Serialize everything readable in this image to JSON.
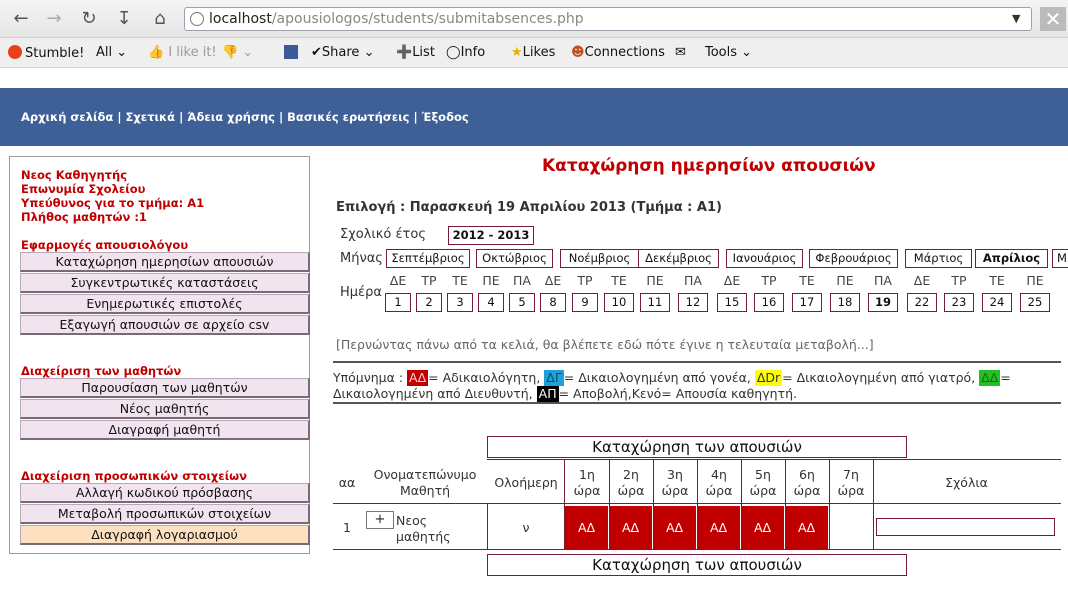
{
  "browser": {
    "url_host": "localhost",
    "url_path": "/apousiologos/students/submitabsences.php"
  },
  "toolbar": {
    "stumble": "Stumble!",
    "all": "All",
    "like": "I like it!",
    "share": "Share",
    "list": "List",
    "info": "Info",
    "likes": "Likes",
    "connections": "Connections",
    "tools": "Tools"
  },
  "topnav": {
    "text": "Αρχική σελίδα | Σχετικά | Άδεια χρήσης | Βασικές ερωτήσεις | Έξοδος"
  },
  "sidebar": {
    "user": "Νεος Καθηγητής",
    "school": "Επωνυμία Σχολείου",
    "responsible": "Υπεύθυνος για το τμήμα: Α1",
    "students_count": "Πλήθος μαθητών :1",
    "apps_title": "Εφαρμογές απουσιολόγου",
    "apps": [
      "Καταχώρηση ημερησίων απουσιών",
      "Συγκεντρωτικές καταστάσεις",
      "Ενημερωτικές επιστολές",
      "Εξαγωγή απουσιών σε αρχείο csv"
    ],
    "students_title": "Διαχείριση των μαθητών",
    "students": [
      "Παρουσίαση των μαθητών",
      "Νέος μαθητής",
      "Διαγραφή μαθητή"
    ],
    "personal_title": "Διαχείριση προσωπικών στοιχείων",
    "personal": [
      "Αλλαγή κωδικού πρόσβασης",
      "Μεταβολή προσωπικών στοιχείων",
      "Διαγραφή λογαριασμού"
    ]
  },
  "main": {
    "title": "Καταχώρηση ημερησίων απουσιών",
    "selection": "Επιλογή : Παρασκευή 19 Απριλίου 2013 (Τμήμα : Α1)",
    "school_year_label": "Σχολικό έτος",
    "school_year": "2012 - 2013",
    "month_label": "Μήνας",
    "months": [
      "Σεπτέμβριος",
      "Οκτώβριος",
      "Νοέμβριος",
      "Δεκέμβριος",
      "Ιανουάριος",
      "Φεβρουάριος",
      "Μάρτιος",
      "Απρίλιος",
      "Μ"
    ],
    "day_label": "Ημέρα",
    "day_names": [
      "ΔΕ",
      "ΤΡ",
      "ΤΕ",
      "ΠΕ",
      "ΠΑ",
      "ΔΕ",
      "ΤΡ",
      "ΤΕ",
      "ΠΕ",
      "ΠΑ",
      "ΔΕ",
      "ΤΡ",
      "ΤΕ",
      "ΠΕ",
      "ΠΑ",
      "ΔΕ",
      "ΤΡ",
      "ΤΕ",
      "ΠΕ"
    ],
    "days": [
      "1",
      "2",
      "3",
      "4",
      "5",
      "8",
      "9",
      "10",
      "11",
      "12",
      "15",
      "16",
      "17",
      "18",
      "19",
      "22",
      "23",
      "24",
      "25"
    ],
    "hint": "[Περνώντας πάνω από τα κελιά, θα βλέπετε εδώ πότε έγινε η τελευταία μεταβολή...]",
    "legend": {
      "prefix": "Υπόμνημα :",
      "ad": "ΑΔ",
      "ad_text": "= Αδικαιολόγητη,",
      "dg": "ΔΓ",
      "dg_text": "= Δικαιολογημένη από γονέα,",
      "ddr": "ΔDr",
      "ddr_text": "= Δικαιολογημένη από γιατρό,",
      "dd": "ΔΔ",
      "dd_text": "= Δικαιολογημένη από Διευθυντή,",
      "ap": "ΑΠ",
      "ap_text": "= Αποβολή,Κενό= Απουσία καθηγητή."
    },
    "section_header": "Καταχώρηση των απουσιών",
    "table": {
      "headers": {
        "aa": "αα",
        "name": "Ονοματεπώνυμο Μαθητή",
        "fullday": "Ολοήμερη",
        "comments": "Σχόλια"
      },
      "hours": [
        "1η ώρα",
        "2η ώρα",
        "3η ώρα",
        "4η ώρα",
        "5η ώρα",
        "6η ώρα",
        "7η ώρα"
      ],
      "rows": [
        {
          "aa": "1",
          "name": "Νεος μαθητής",
          "fullday": "ν",
          "plus": "+",
          "hours": [
            "ΑΔ",
            "ΑΔ",
            "ΑΔ",
            "ΑΔ",
            "ΑΔ",
            "ΑΔ",
            ""
          ]
        }
      ]
    },
    "colors": {
      "absence": "#c00000",
      "header_band": "#3f5f97",
      "accent_red": "#c00000"
    }
  }
}
